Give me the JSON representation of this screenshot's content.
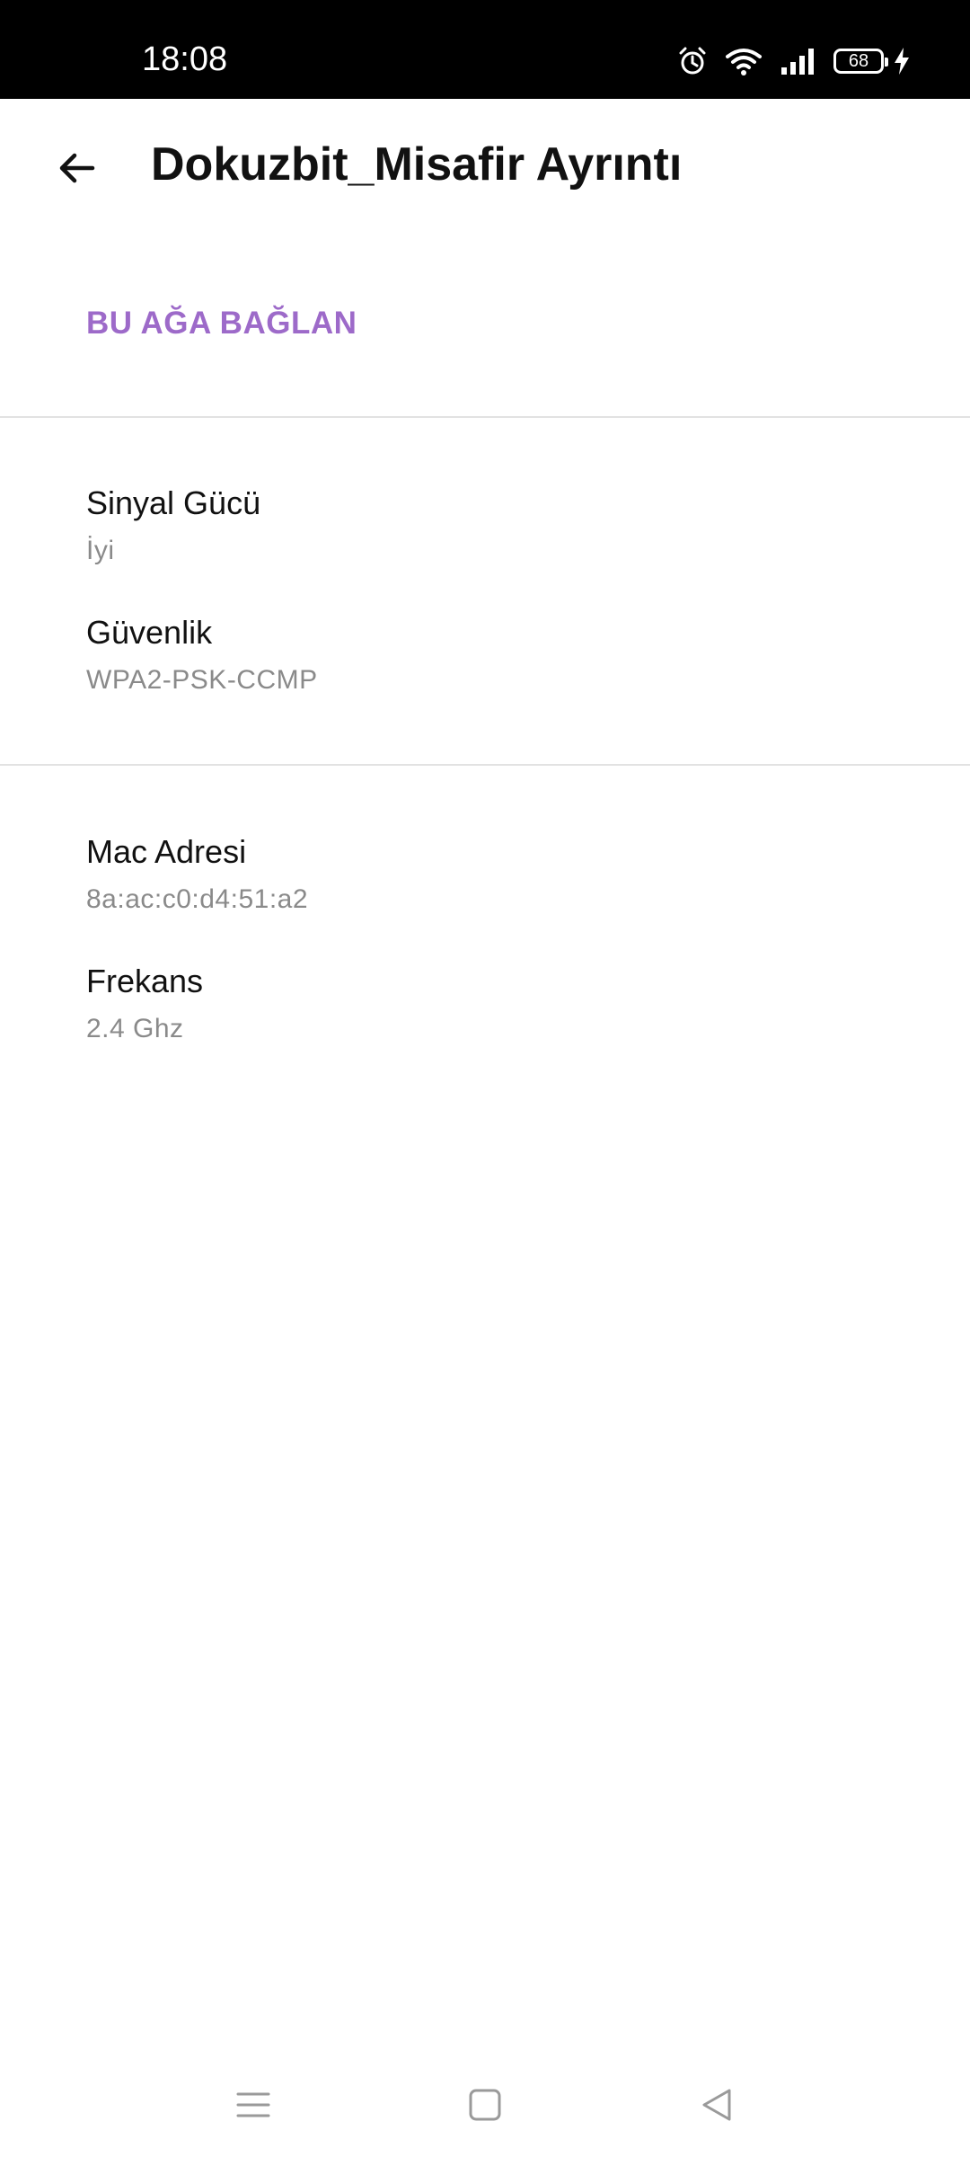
{
  "status_bar": {
    "time": "18:08",
    "battery": "68",
    "icons": [
      "alarm-icon",
      "wifi-icon",
      "signal-icon",
      "battery-icon",
      "charging-icon"
    ]
  },
  "header": {
    "title": "Dokuzbit_Misafir Ayrıntı",
    "back_icon": "arrow-back-icon"
  },
  "actions": {
    "connect_label": "BU AĞA BAĞLAN"
  },
  "details": [
    {
      "label": "Sinyal Gücü",
      "value": "İyi"
    },
    {
      "label": "Güvenlik",
      "value": "WPA2-PSK-CCMP"
    },
    {
      "label": "Mac Adresi",
      "value": "8a:ac:c0:d4:51:a2"
    },
    {
      "label": "Frekans",
      "value": "2.4 Ghz"
    }
  ],
  "nav_bar": [
    "menu-icon",
    "home-icon",
    "back-triangle-icon"
  ],
  "colors": {
    "accent": "#9d6ac9",
    "statusbar": "#000000",
    "divider": "#e2e2e2",
    "secondary_text": "#8a8a8a"
  }
}
